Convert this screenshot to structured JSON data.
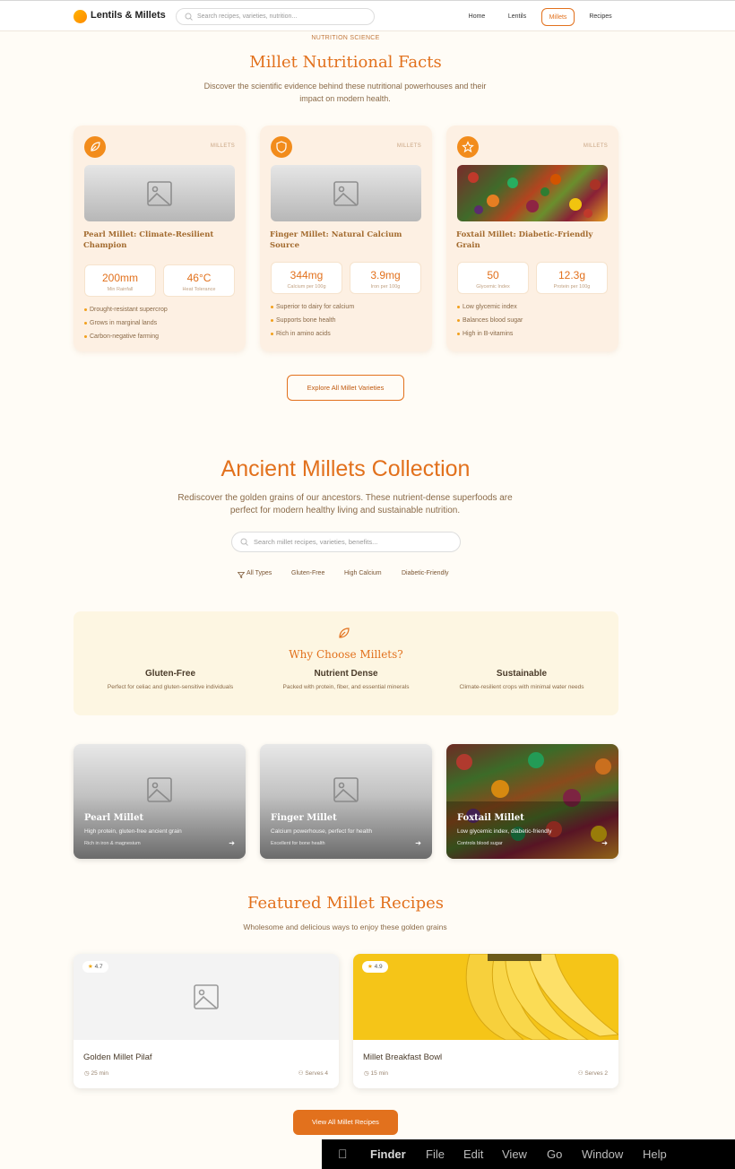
{
  "header": {
    "logo_text": "Lentils & Millets",
    "search_placeholder": "Search recipes, varieties, nutrition...",
    "nav": [
      "Home",
      "Lentils",
      "Millets",
      "Recipes"
    ],
    "active_nav": "Millets"
  },
  "nutrition": {
    "kicker": "NUTRITION SCIENCE",
    "title": "Millet Nutritional Facts",
    "subtitle": "Discover the scientific evidence behind these nutritional powerhouses and their impact on modern health.",
    "cards": [
      {
        "icon": "leaf-icon",
        "tag": "MILLETS",
        "title": "Pearl Millet: Climate-Resilient Champion",
        "stats": [
          {
            "value": "200mm",
            "label": "Min Rainfall"
          },
          {
            "value": "46°C",
            "label": "Heat Tolerance"
          }
        ],
        "bullets": [
          "Drought-resistant supercrop",
          "Grows in marginal lands",
          "Carbon-negative farming"
        ]
      },
      {
        "icon": "shield-icon",
        "tag": "MILLETS",
        "title": "Finger Millet: Natural Calcium Source",
        "stats": [
          {
            "value": "344mg",
            "label": "Calcium per 100g"
          },
          {
            "value": "3.9mg",
            "label": "Iron per 100g"
          }
        ],
        "bullets": [
          "Superior to dairy for calcium",
          "Supports bone health",
          "Rich in amino acids"
        ]
      },
      {
        "icon": "star-icon",
        "tag": "MILLETS",
        "title": "Foxtail Millet: Diabetic-Friendly Grain",
        "stats": [
          {
            "value": "50",
            "label": "Glycemic Index"
          },
          {
            "value": "12.3g",
            "label": "Protein per 100g"
          }
        ],
        "bullets": [
          "Low glycemic index",
          "Balances blood sugar",
          "High in B-vitamins"
        ]
      }
    ],
    "explore_button": "Explore All Millet Varieties"
  },
  "collection": {
    "title": "Ancient Millets Collection",
    "subtitle": "Rediscover the golden grains of our ancestors. These nutrient-dense superfoods are perfect for modern healthy living and sustainable nutrition.",
    "search_placeholder": "Search millet recipes, varieties, benefits...",
    "filters": [
      "All Types",
      "Gluten-Free",
      "High Calcium",
      "Diabetic-Friendly"
    ]
  },
  "why": {
    "title": "Why Choose Millets?",
    "cols": [
      {
        "title": "Gluten-Free",
        "desc": "Perfect for celiac and gluten-sensitive individuals"
      },
      {
        "title": "Nutrient Dense",
        "desc": "Packed with protein, fiber, and essential minerals"
      },
      {
        "title": "Sustainable",
        "desc": "Climate-resilient crops with minimal water needs"
      }
    ]
  },
  "millets": [
    {
      "name": "Pearl Millet",
      "desc": "High protein, gluten-free ancient grain",
      "note": "Rich in iron & magnesium"
    },
    {
      "name": "Finger Millet",
      "desc": "Calcium powerhouse, perfect for health",
      "note": "Excellent for bone health"
    },
    {
      "name": "Foxtail Millet",
      "desc": "Low glycemic index, diabetic-friendly",
      "note": "Controls blood sugar"
    }
  ],
  "recipes": {
    "title": "Featured Millet Recipes",
    "subtitle": "Wholesome and delicious ways to enjoy these golden grains",
    "items": [
      {
        "rating": "4.7",
        "title": "Golden Millet Pilaf",
        "time": "25 min",
        "serves": "Serves 4"
      },
      {
        "rating": "4.9",
        "title": "Millet Breakfast Bowl",
        "time": "15 min",
        "serves": "Serves 2"
      }
    ],
    "view_all": "View All Millet Recipes"
  },
  "menubar": {
    "items": [
      "Finder",
      "File",
      "Edit",
      "View",
      "Go",
      "Window",
      "Help"
    ]
  },
  "colors": {
    "accent": "#e2711d",
    "card_bg": "#fdf0e3",
    "page_bg": "#fffcf6"
  }
}
